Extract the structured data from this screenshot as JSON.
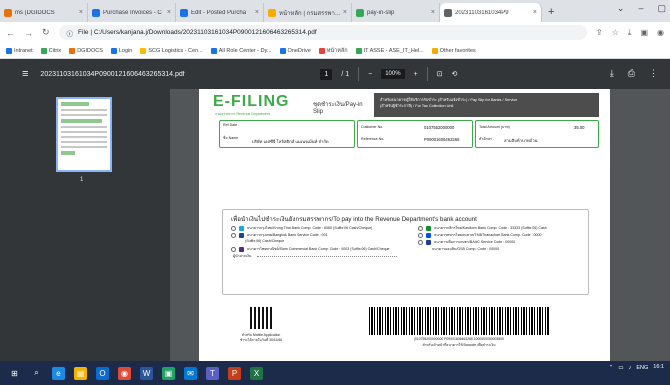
{
  "tabs": [
    {
      "label": "ms (DGIDOCS",
      "color": "#e8710a"
    },
    {
      "label": "Purchase Invoices - C",
      "color": "#1a73e8"
    },
    {
      "label": "Edit - Posted Purcha",
      "color": "#1a73e8"
    },
    {
      "label": "หน้าหลัก | กรมสรรพากร",
      "color": "#f9ab00"
    },
    {
      "label": "pay-in-slip",
      "color": "#34a853"
    },
    {
      "label": "20231103161034P9",
      "color": "#5f6368",
      "active": true
    }
  ],
  "address": {
    "url": "File | C:/Users/kanjana.j/Downloads/20231103161034P0900121606463265314.pdf"
  },
  "bookmarks": [
    {
      "label": "Intranet",
      "color": "#1a73e8"
    },
    {
      "label": "Citrix",
      "color": "#34a853"
    },
    {
      "label": "DGIDOCS",
      "color": "#e8710a"
    },
    {
      "label": "Login",
      "color": "#1a73e8"
    },
    {
      "label": "SCG Logistics - Cen...",
      "color": "#fbbc04"
    },
    {
      "label": "All Role Center - Dy...",
      "color": "#1a73e8"
    },
    {
      "label": "OneDrive",
      "color": "#1a73e8"
    },
    {
      "label": "หน้าหลัก",
      "color": "#ea4335"
    },
    {
      "label": "IT ASSE - ASE_IT_Hel...",
      "color": "#34a853"
    },
    {
      "label": "Other favorites",
      "color": "#f9ab00"
    }
  ],
  "pdf": {
    "filename": "20231103161034P0900121606463265314.pdf",
    "page": "1",
    "total": "/ 1",
    "zoom": "100%",
    "thumb_page": "1"
  },
  "doc": {
    "logo": "E-FILING",
    "logo_sub": "กรมสรรพากร Revenue Department",
    "slip_title": "ชุดชำระเงิน/Pay-in Slip",
    "dark_line1": "สำหรับธนาคาร/ผู้ให้บริการรับชำระ (สำหรับแจ้งชำระ) / Pay Slip for Banks / Service",
    "dark_line2": "(สำหรับผู้ชำระภาษี) / For Tax Collection Unit",
    "box1_l1": "Ref Date",
    "box1_l2": "ชื่อ Name",
    "box1_v2": "บริษัท เอสซีจี โลจิสติกส์ แมเนจเม้นท์ จำกัด",
    "box2_l1": "Customer No.",
    "box2_v1": "0107552000000",
    "box2_l2": "Reference No.",
    "box2_v2": "P09001606463265",
    "box3_l1": "Total Amount (บาท)",
    "box3_v1": "35.00",
    "box3_l2": "ตัวอักษร",
    "box3_v2": "สามสิบห้าบาทถ้วน",
    "pay_head": "เพื่อนำเงินไปชำระเงินยังกรมสรรพากร/To pay into the Revenue Department's bank account",
    "banks_left": [
      "ธนาคารกรุงไทย/Krung Thai Bank Comp. Code : 6060 (Suffix:06 Cash/Cheque)",
      "ธนาคารกรุงเทพ/Bangkok Bank Service Code : 001",
      "(Suffix:06) Cash/Cheque",
      "ธนาคารไทยพาณิชย์/Siam Commercial Bank Comp. Code : 0003 (Suffix:06) Cash/Cheque"
    ],
    "banks_right": [
      "ธนาคารกสิกรไทย/Kasikorn Bank Comp. Code : 33333 (Suffix:06) Cash",
      "ธนาคารทหารไทยธนชาต/TMBThanachart Bank Comp. Code : 0000",
      "ธนาคารเพื่อการเกษตร/BAAC Service Code : 00000",
      "ธนาคารออมสิน/GSB Comp. Code : 00000"
    ],
    "sign_label": "ผู้นำฝากเงิน",
    "qr_cap1": "สำหรับ Mobile Application",
    "qr_cap2": "ชำระได้ภายในวันที่ 30/11/66",
    "barcode_num": "|010755200000000 P09001606463265 1000000000003500",
    "barcode_note": "สำหรับเจ้าหน้าที่ธนาคารใช้ Barcode เพื่อชำระเงิน"
  },
  "clock": {
    "time": "16:1",
    "lang": "ENG"
  }
}
